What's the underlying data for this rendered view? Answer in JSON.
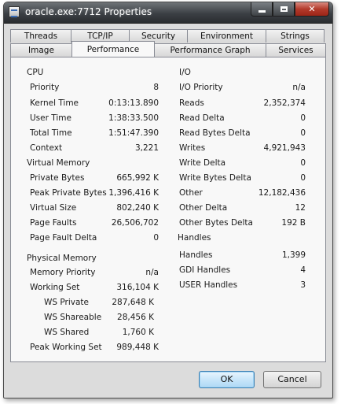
{
  "window": {
    "title": "oracle.exe:7712 Properties"
  },
  "tabs": {
    "back": [
      "Threads",
      "TCP/IP",
      "Security",
      "Environment",
      "Strings"
    ],
    "front": [
      "Image",
      "Performance",
      "Performance Graph",
      "Services"
    ]
  },
  "cpu": {
    "header": "CPU",
    "rows": [
      {
        "label": "Priority",
        "value": "8"
      },
      {
        "label": "Kernel Time",
        "value": "0:13:13.890"
      },
      {
        "label": "User Time",
        "value": "1:38:33.500"
      },
      {
        "label": "Total Time",
        "value": "1:51:47.390"
      },
      {
        "label": "Context",
        "value": "3,221"
      }
    ]
  },
  "virtual_memory": {
    "header": "Virtual Memory",
    "rows": [
      {
        "label": "Private Bytes",
        "value": "665,992 K"
      },
      {
        "label": "Peak Private Bytes",
        "value": "1,396,416 K"
      },
      {
        "label": "Virtual Size",
        "value": "802,240 K"
      },
      {
        "label": "Page Faults",
        "value": "26,506,702"
      },
      {
        "label": "Page Fault Delta",
        "value": "0"
      }
    ]
  },
  "physical_memory": {
    "header": "Physical Memory",
    "rows": [
      {
        "label": "Memory Priority",
        "value": "n/a"
      },
      {
        "label": "Working Set",
        "value": "316,104 K"
      },
      {
        "label": "WS Private",
        "value": "287,648 K"
      },
      {
        "label": "WS Shareable",
        "value": "28,456 K"
      },
      {
        "label": "WS Shared",
        "value": "1,760 K"
      },
      {
        "label": "Peak Working Set",
        "value": "989,448 K"
      }
    ]
  },
  "io": {
    "header": "I/O",
    "rows": [
      {
        "label": "I/O Priority",
        "value": "n/a"
      },
      {
        "label": "Reads",
        "value": "2,352,374"
      },
      {
        "label": "Read Delta",
        "value": "0"
      },
      {
        "label": "Read Bytes Delta",
        "value": "0"
      },
      {
        "label": "Writes",
        "value": "4,921,943"
      },
      {
        "label": "Write Delta",
        "value": "0"
      },
      {
        "label": "Write Bytes Delta",
        "value": "0"
      },
      {
        "label": "Other",
        "value": "12,182,436"
      },
      {
        "label": "Other Delta",
        "value": "12"
      },
      {
        "label": "Other Bytes Delta",
        "value": "192 B"
      }
    ]
  },
  "handles": {
    "header": "Handles",
    "rows": [
      {
        "label": "Handles",
        "value": "1,399"
      },
      {
        "label": "GDI Handles",
        "value": "4"
      },
      {
        "label": "USER Handles",
        "value": "3"
      }
    ]
  },
  "buttons": {
    "ok": "OK",
    "cancel": "Cancel"
  },
  "colors": {
    "title_bar": "#3b3f44",
    "close_button": "#b33a2b",
    "dialog_bg": "#dcdcdc",
    "panel_bg": "#f8f8f8",
    "default_button": "#c8e6fa"
  }
}
